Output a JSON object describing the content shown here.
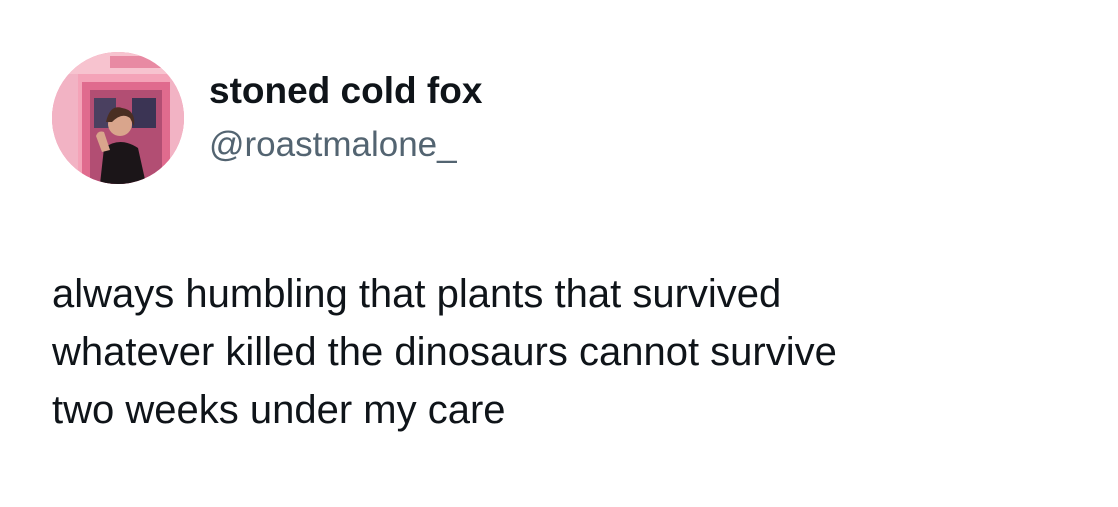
{
  "author": {
    "display_name": "stoned cold fox",
    "handle": "@roastmalone_"
  },
  "tweet": {
    "lines": [
      "always humbling that plants that survived",
      "whatever killed the dinosaurs cannot survive",
      "two weeks under my care"
    ]
  },
  "colors": {
    "text_primary": "#0f1419",
    "text_secondary": "#536471",
    "background": "#ffffff"
  },
  "icons": {
    "avatar": "profile-photo"
  }
}
